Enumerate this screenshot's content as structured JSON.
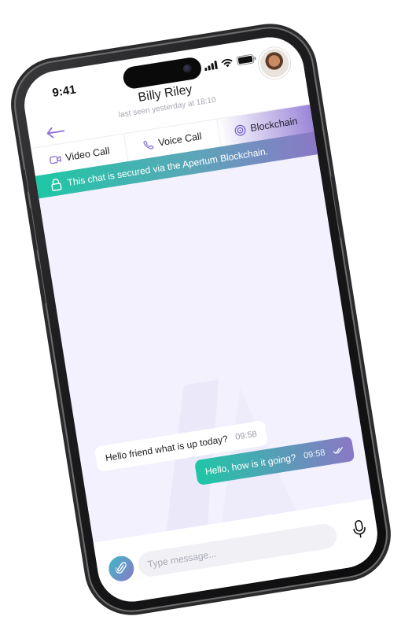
{
  "status_bar": {
    "time": "9:41"
  },
  "contact": {
    "name": "Billy Riley",
    "last_seen": "last seen yesterday at 18:10"
  },
  "tabs": [
    {
      "label": "Video Call",
      "icon": "video-icon"
    },
    {
      "label": "Voice Call",
      "icon": "phone-icon"
    },
    {
      "label": "Blockchain",
      "icon": "blockchain-icon"
    }
  ],
  "banner": {
    "text": "This chat is secured via the Apertum Blockchain.",
    "icon": "lock-icon"
  },
  "messages": [
    {
      "direction": "incoming",
      "text": "Hello friend what is up today?",
      "time": "09:58"
    },
    {
      "direction": "outgoing",
      "text": "Hello, how is it going?",
      "time": "09:58",
      "status": "read"
    }
  ],
  "composer": {
    "placeholder": "Type message..."
  },
  "colors": {
    "accent_teal": "#1ec7a5",
    "accent_purple": "#8a78c6",
    "chat_bg": "#f3f1fe"
  }
}
